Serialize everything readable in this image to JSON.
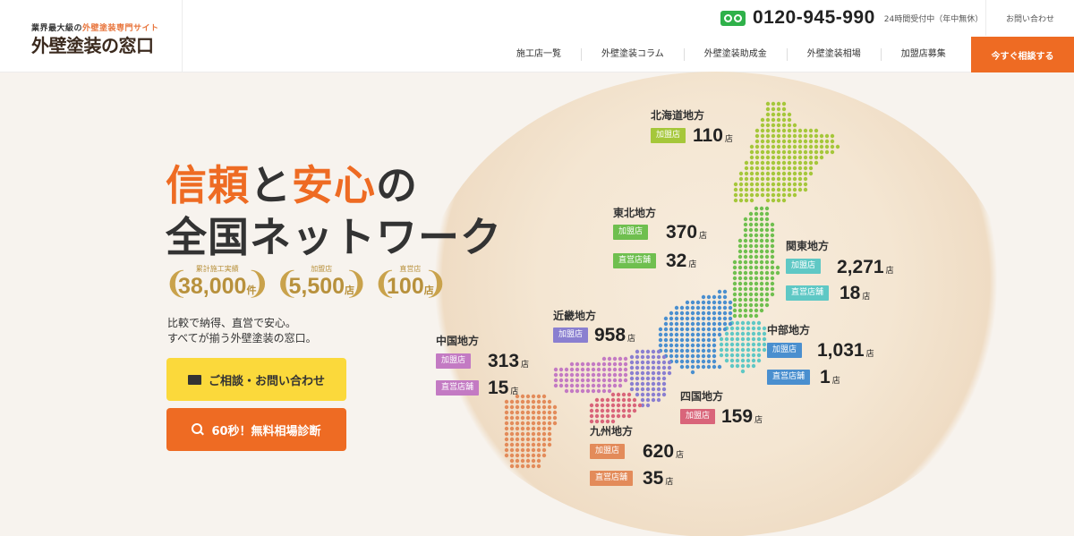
{
  "header": {
    "logo_tagline_prefix": "業界最大級の",
    "logo_tagline_accent": "外壁塗装専門サイト",
    "logo_name": "外壁塗装の窓口",
    "phone": "0120-945-990",
    "phone_note": "24時間受付中（年中無休）",
    "contact_link": "お問い合わせ",
    "nav": [
      "施工店一覧",
      "外壁塗装コラム",
      "外壁塗装助成金",
      "外壁塗装相場",
      "加盟店募集"
    ],
    "cta": "今すぐ相談する"
  },
  "hero": {
    "line1_a": "信頼",
    "line1_b": "と",
    "line1_c": "安心",
    "line1_d": "の",
    "line2": "全国ネットワーク",
    "stats": [
      {
        "label": "累計施工実績",
        "value": "38,000",
        "unit": "件"
      },
      {
        "label": "加盟店",
        "value": "5,500",
        "unit": "店"
      },
      {
        "label": "直営店",
        "value": "100",
        "unit": "店"
      }
    ],
    "subcopy_1": "比較で納得、直営で安心。",
    "subcopy_2": "すべてが揃う外壁塗装の窓口。",
    "btn_consult": "ご相談・お問い合わせ",
    "btn_diagnose": "60秒！無料相場診断"
  },
  "colors": {
    "accent": "#ee6b23",
    "hokkaido": "#a5c73a",
    "tohoku": "#6fbf4f",
    "kanto": "#5fc8c5",
    "chubu": "#4a8fcf",
    "kinki": "#8a7fd0",
    "chugoku": "#c37ac3",
    "shikoku": "#d9657a",
    "kyushu": "#e38b5a"
  },
  "map": {
    "unit": "店",
    "label_member": "加盟店",
    "label_direct": "直営店舗",
    "regions": {
      "hokkaido": {
        "name": "北海道地方",
        "member": "110"
      },
      "tohoku": {
        "name": "東北地方",
        "member": "370",
        "direct": "32"
      },
      "kanto": {
        "name": "関東地方",
        "member": "2,271",
        "direct": "18"
      },
      "chubu": {
        "name": "中部地方",
        "member": "1,031",
        "direct": "1"
      },
      "kinki": {
        "name": "近畿地方",
        "member": "958"
      },
      "chugoku": {
        "name": "中国地方",
        "member": "313",
        "direct": "15"
      },
      "shikoku": {
        "name": "四国地方",
        "member": "159"
      },
      "kyushu": {
        "name": "九州地方",
        "member": "620",
        "direct": "35"
      }
    }
  }
}
